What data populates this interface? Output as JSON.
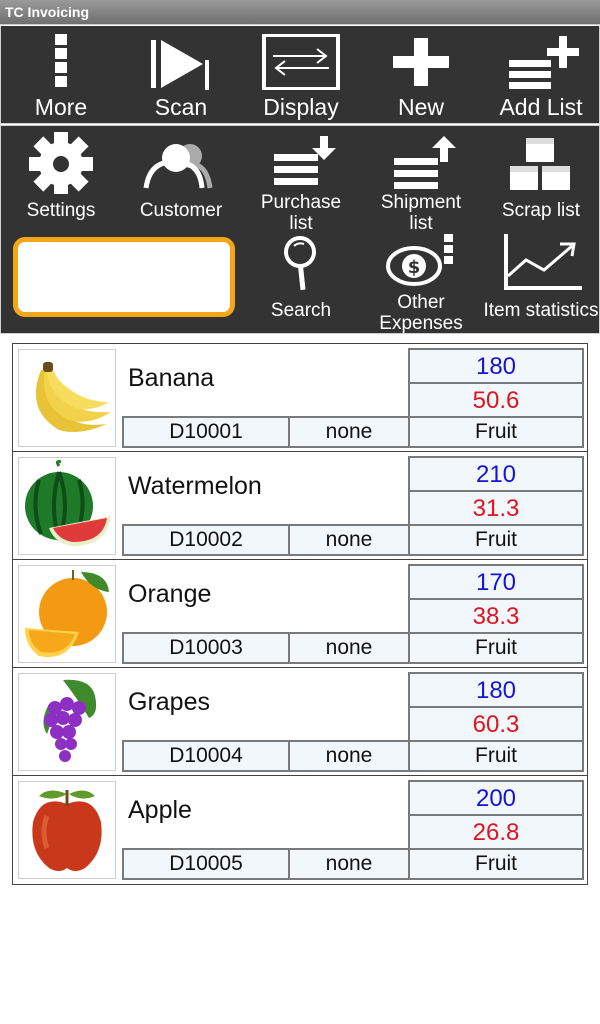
{
  "app": {
    "title": "TC Invoicing"
  },
  "toolbar_top": [
    {
      "label": "More",
      "icon": "more-vertical-icon"
    },
    {
      "label": "Scan",
      "icon": "scan-play-icon"
    },
    {
      "label": "Display",
      "icon": "swap-arrows-icon"
    },
    {
      "label": "New",
      "icon": "plus-icon"
    },
    {
      "label": "Add List",
      "icon": "add-list-icon"
    }
  ],
  "toolbar_bottom": [
    {
      "label": "Settings",
      "icon": "gear-icon"
    },
    {
      "label": "Customer",
      "icon": "customer-icon"
    },
    {
      "label": "Purchase list",
      "line1": "Purchase",
      "line2": "list",
      "icon": "purchase-list-icon"
    },
    {
      "label": "Shipment list",
      "line1": "Shipment",
      "line2": "list",
      "icon": "shipment-list-icon"
    },
    {
      "label": "Scrap list",
      "icon": "scrap-boxes-icon"
    },
    {
      "label": "Search",
      "icon": "magnifier-icon"
    },
    {
      "label": "Other Expenses",
      "line1": "Other",
      "line2": "Expenses",
      "icon": "dollar-coin-icon"
    },
    {
      "label": "Item statistics",
      "icon": "line-chart-icon"
    }
  ],
  "search": {
    "value": "",
    "placeholder": ""
  },
  "colors": {
    "accent": "#f5a614",
    "qty": "#1414d6",
    "price": "#e0141e",
    "toolbar_bg": "#333333"
  },
  "items": [
    {
      "name": "Banana",
      "code": "D10001",
      "option": "none",
      "category": "Fruit",
      "qty": "180",
      "price": "50.6",
      "image": "banana"
    },
    {
      "name": "Watermelon",
      "code": "D10002",
      "option": "none",
      "category": "Fruit",
      "qty": "210",
      "price": "31.3",
      "image": "watermelon"
    },
    {
      "name": "Orange",
      "code": "D10003",
      "option": "none",
      "category": "Fruit",
      "qty": "170",
      "price": "38.3",
      "image": "orange"
    },
    {
      "name": "Grapes",
      "code": "D10004",
      "option": "none",
      "category": "Fruit",
      "qty": "180",
      "price": "60.3",
      "image": "grapes"
    },
    {
      "name": "Apple",
      "code": "D10005",
      "option": "none",
      "category": "Fruit",
      "qty": "200",
      "price": "26.8",
      "image": "apple"
    }
  ]
}
